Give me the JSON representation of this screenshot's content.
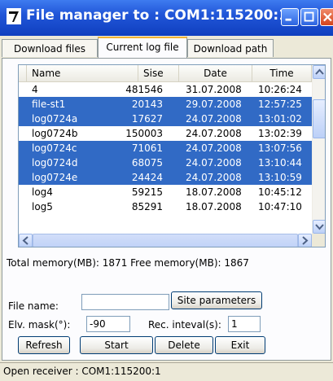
{
  "window": {
    "title": "File manager to : COM1:115200:1"
  },
  "tabs": [
    {
      "label": "Download files",
      "active": false
    },
    {
      "label": "Current log file",
      "active": true
    },
    {
      "label": "Download path",
      "active": false
    }
  ],
  "list": {
    "columns": [
      "Name",
      "Sise",
      "Date",
      "Time"
    ],
    "rows": [
      {
        "name": "4",
        "size": "481546",
        "date": "31.07.2008",
        "time": "10:26:24",
        "selected": false
      },
      {
        "name": "file-st1",
        "size": "20143",
        "date": "29.07.2008",
        "time": "12:57:25",
        "selected": true
      },
      {
        "name": "log0724a",
        "size": "17627",
        "date": "24.07.2008",
        "time": "13:01:02",
        "selected": true
      },
      {
        "name": "log0724b",
        "size": "150003",
        "date": "24.07.2008",
        "time": "13:02:39",
        "selected": false
      },
      {
        "name": "log0724c",
        "size": "71061",
        "date": "24.07.2008",
        "time": "13:07:56",
        "selected": true
      },
      {
        "name": "log0724d",
        "size": "68075",
        "date": "24.07.2008",
        "time": "13:10:44",
        "selected": true
      },
      {
        "name": "log0724e",
        "size": "24424",
        "date": "24.07.2008",
        "time": "13:10:59",
        "selected": true
      },
      {
        "name": "log4",
        "size": "59215",
        "date": "18.07.2008",
        "time": "10:45:12",
        "selected": false
      },
      {
        "name": "log5",
        "size": "85291",
        "date": "18.07.2008",
        "time": "10:47:10",
        "selected": false
      }
    ]
  },
  "memory": {
    "text": "Total memory(MB): 1871  Free memory(MB): 1867"
  },
  "form": {
    "file_name_label": "File name:",
    "file_name_value": "",
    "site_parameters_label": "Site parameters",
    "elv_mask_label": "Elv. mask(°):",
    "elv_mask_value": "-90",
    "rec_interval_label": "Rec. inteval(s):",
    "rec_interval_value": "1"
  },
  "buttons": {
    "refresh": "Refresh",
    "start": "Start",
    "delete": "Delete",
    "exit": "Exit"
  },
  "status": {
    "text": "Open receiver : COM1:115200:1"
  },
  "colors": {
    "selection": "#316ac5",
    "titlebar": "#2156d8",
    "close_button": "#d4431c"
  }
}
